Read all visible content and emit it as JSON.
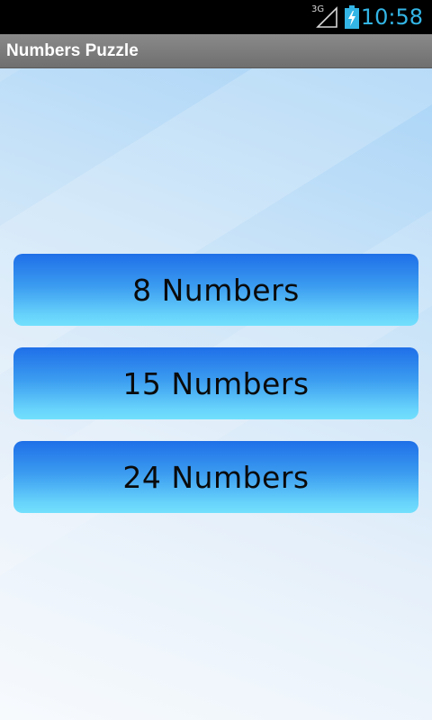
{
  "status_bar": {
    "network_label": "3G",
    "time": "10:58",
    "accent_color": "#33b5e5"
  },
  "app": {
    "title": "Numbers Puzzle"
  },
  "menu": {
    "buttons": [
      {
        "label": "8 Numbers"
      },
      {
        "label": "15 Numbers"
      },
      {
        "label": "24 Numbers"
      }
    ]
  }
}
